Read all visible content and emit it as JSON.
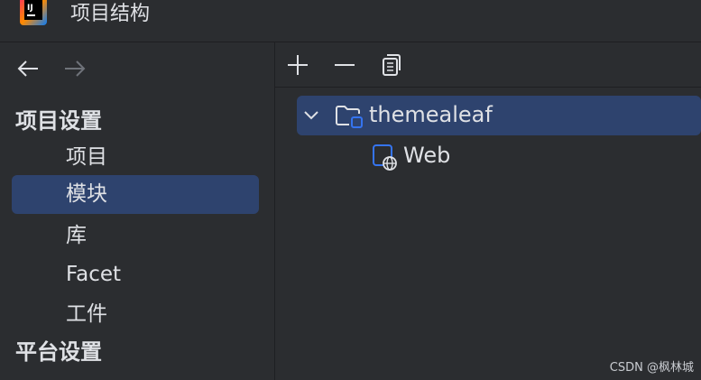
{
  "window": {
    "title": "项目结构"
  },
  "sidebar": {
    "sections": [
      {
        "header": "项目设置"
      },
      {
        "header": "平台设置"
      }
    ],
    "items": [
      {
        "label": "项目",
        "selected": false
      },
      {
        "label": "模块",
        "selected": true
      },
      {
        "label": "库",
        "selected": false
      },
      {
        "label": "Facet",
        "selected": false
      },
      {
        "label": "工件",
        "selected": false
      }
    ]
  },
  "toolbar": {
    "buttons": [
      "add-icon",
      "remove-icon",
      "copy-icon"
    ]
  },
  "tree": {
    "nodes": [
      {
        "label": "themealeaf",
        "icon": "module-folder-icon",
        "expanded": true,
        "selected": true
      },
      {
        "label": "Web",
        "icon": "web-facet-icon",
        "selected": false
      }
    ]
  },
  "watermark": "CSDN @枫林城",
  "colors": {
    "background": "#2b2d30",
    "selection": "#2e436e",
    "text": "#dfe1e5",
    "accent": "#3574f0"
  }
}
